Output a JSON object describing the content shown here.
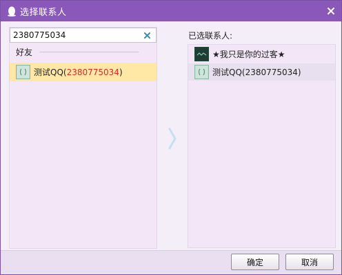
{
  "window": {
    "title": "选择联系人"
  },
  "search": {
    "value": "2380775034"
  },
  "group": {
    "label": "好友"
  },
  "left_contacts": [
    {
      "name": "测试QQ(",
      "number": "2380775034",
      "suffix": ")",
      "avatar": "qq-avatar-icon"
    }
  ],
  "selected_panel": {
    "title": "已选联系人:",
    "items": [
      {
        "name": "★我只是你的过客★",
        "avatar": "dark-avatar-icon"
      },
      {
        "name": "测试QQ(2380775034)",
        "avatar": "qq-avatar-icon"
      }
    ]
  },
  "buttons": {
    "ok": "确定",
    "cancel": "取消"
  },
  "colors": {
    "titlebar": "#8a58b8",
    "selected_row": "#ffe8a6",
    "qq_number": "#e0242c",
    "panel": "#f3e7f7"
  }
}
